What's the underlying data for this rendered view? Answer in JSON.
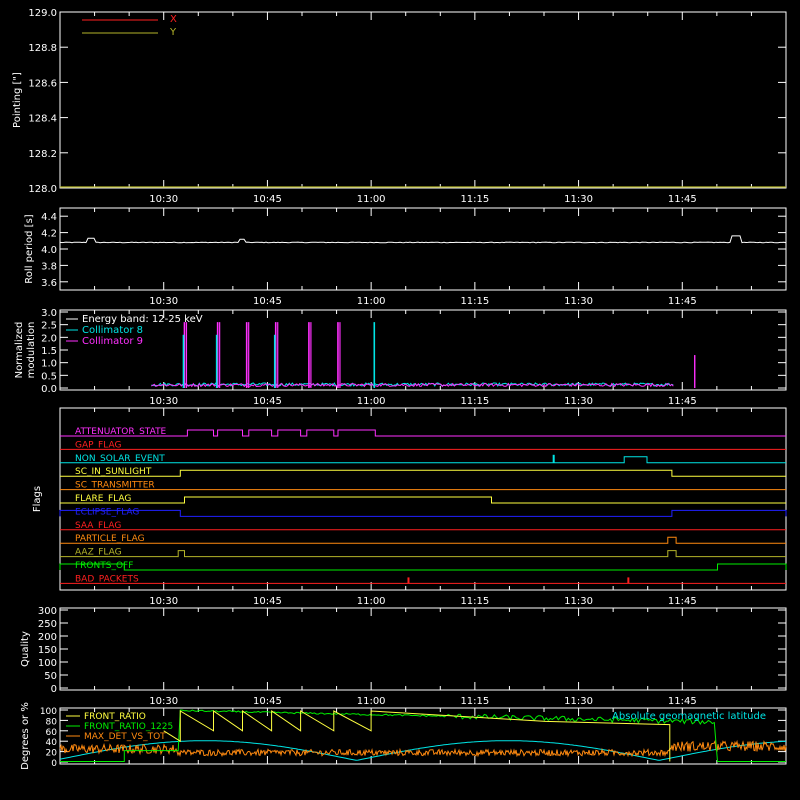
{
  "time_ticks": [
    "10:30",
    "10:45",
    "11:00",
    "11:15",
    "11:30",
    "11:45"
  ],
  "colors": {
    "x": "#ff2020",
    "y": "#b5b52a",
    "c8": "#00e5e5",
    "c9": "#ff30ff",
    "white": "#ffffff",
    "green": "#00ee00",
    "yellow": "#ffff40",
    "orange": "#ff8a10",
    "cyan": "#00e5e5"
  },
  "chart_data": [
    {
      "type": "line",
      "ylabel": "Pointing [\"]",
      "ylim": [
        128.0,
        129.0
      ],
      "yticks": [
        "129.0",
        "128.8",
        "128.6",
        "128.4",
        "128.2",
        "128.0"
      ],
      "legend": [
        {
          "name": "X",
          "color": "#ff2020"
        },
        {
          "name": "Y",
          "color": "#b5b52a"
        }
      ],
      "series": [
        {
          "name": "Y",
          "value": 128.0
        }
      ]
    },
    {
      "type": "line",
      "ylabel": "Roll period [s]",
      "ylim": [
        3.5,
        4.5
      ],
      "yticks": [
        "4.4",
        "4.2",
        "4.0",
        "3.8",
        "3.6"
      ],
      "series": [
        {
          "name": "roll",
          "base": 4.08
        }
      ]
    },
    {
      "type": "line",
      "ylabel": "Normalized modulation",
      "ylabel_lines": [
        "Normalized",
        "modulation"
      ],
      "ylim": [
        0.0,
        3.0
      ],
      "yticks": [
        "3.0",
        "2.5",
        "2.0",
        "1.5",
        "1.0",
        "0.5",
        "0.0"
      ],
      "legend": [
        {
          "name": "Energy band: 12-25 keV",
          "color": "#ffffff"
        },
        {
          "name": "Collimator 8",
          "color": "#00e5e5"
        },
        {
          "name": "Collimator 9",
          "color": "#ff30ff"
        }
      ],
      "spikes_c9": [
        10.55,
        10.63,
        10.7,
        10.77,
        10.85,
        10.92
      ],
      "spikes_c8": [
        10.55,
        10.63,
        10.77,
        11.01
      ]
    },
    {
      "type": "line",
      "ylabel": "Flags",
      "flags": [
        {
          "name": "ATTENUATOR_STATE",
          "color": "#ff30ff"
        },
        {
          "name": "GAP_FLAG",
          "color": "#ff2020"
        },
        {
          "name": "NON_SOLAR_EVENT",
          "color": "#00e5e5"
        },
        {
          "name": "SC_IN_SUNLIGHT",
          "color": "#ffff40"
        },
        {
          "name": "SC_TRANSMITTER",
          "color": "#ff8a10"
        },
        {
          "name": "FLARE_FLAG",
          "color": "#ffff40"
        },
        {
          "name": "ECLIPSE_FLAG",
          "color": "#2020ff"
        },
        {
          "name": "SAA_FLAG",
          "color": "#ff2020"
        },
        {
          "name": "PARTICLE_FLAG",
          "color": "#ff8a10"
        },
        {
          "name": "AAZ_FLAG",
          "color": "#b5b52a"
        },
        {
          "name": "FRONTS_OFF",
          "color": "#00ee00"
        },
        {
          "name": "BAD_PACKETS",
          "color": "#ff2020"
        }
      ]
    },
    {
      "type": "line",
      "ylabel": "Quality",
      "ylim": [
        0,
        300
      ],
      "yticks": [
        "300",
        "250",
        "200",
        "150",
        "100",
        "50",
        "0"
      ]
    },
    {
      "type": "line",
      "ylabel": "Degrees or %",
      "ylim": [
        0,
        100
      ],
      "yticks": [
        "100",
        "80",
        "60",
        "40",
        "20",
        "0"
      ],
      "legend": [
        {
          "name": "FRONT_RATIO",
          "color": "#ffff40"
        },
        {
          "name": "FRONT_RATIO_1225",
          "color": "#00ee00"
        },
        {
          "name": "MAX_DET_VS_TOT",
          "color": "#ff8a10"
        }
      ],
      "annotation": {
        "text": "Absolute geomagnetic latitude",
        "color": "#00e5e5"
      }
    }
  ]
}
